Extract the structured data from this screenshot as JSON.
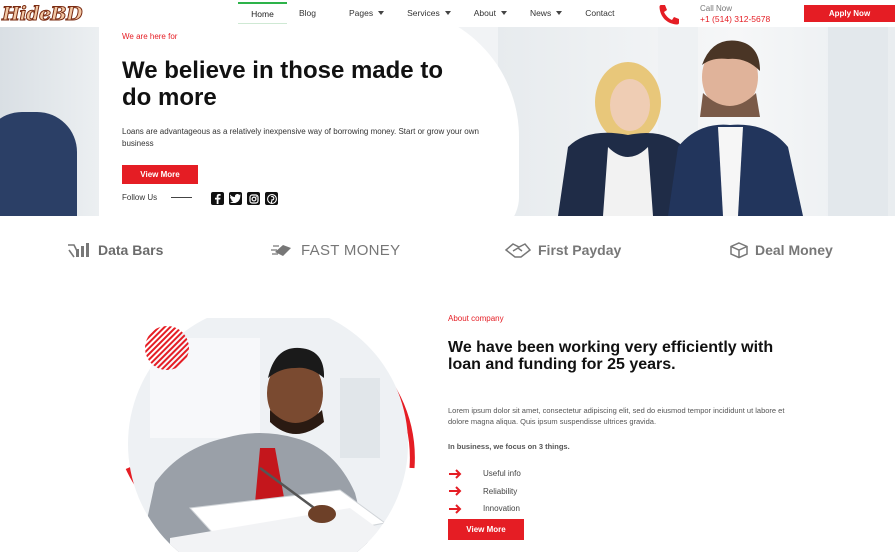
{
  "header": {
    "logo_text": "HideBD",
    "nav": [
      {
        "label": "Home",
        "has_dropdown": false,
        "active": true
      },
      {
        "label": "Blog",
        "has_dropdown": false,
        "active": false
      },
      {
        "label": "Pages",
        "has_dropdown": true,
        "active": false
      },
      {
        "label": "Services",
        "has_dropdown": true,
        "active": false
      },
      {
        "label": "About",
        "has_dropdown": true,
        "active": false
      },
      {
        "label": "News",
        "has_dropdown": true,
        "active": false
      },
      {
        "label": "Contact",
        "has_dropdown": false,
        "active": false
      }
    ],
    "call_label": "Call Now",
    "call_number": "+1 (514) 312-5678",
    "phone_icon": "phone-icon",
    "apply_label": "Apply Now"
  },
  "hero": {
    "kicker": "We are here for",
    "title": "We believe in those made to do more",
    "description": "Loans are advantageous as a relatively inexpensive way of borrowing money. Start or grow your own business",
    "button_label": "View More",
    "follow_label": "Follow Us",
    "socials": [
      "facebook-icon",
      "twitter-icon",
      "instagram-icon",
      "pinterest-icon"
    ]
  },
  "brands": [
    {
      "name": "Data Bars",
      "icon": "data-bars-icon"
    },
    {
      "name": "FAST MONEY",
      "icon": "fast-money-icon"
    },
    {
      "name": "First Payday",
      "icon": "handshake-icon"
    },
    {
      "name": "Deal Money",
      "icon": "box-icon"
    }
  ],
  "about": {
    "kicker": "About company",
    "title": "We have been working very efficiently with loan and funding for 25 years.",
    "description": "Lorem ipsum dolor sit amet, consectetur adipiscing elit, sed do eiusmod tempor incididunt ut labore et dolore magna aliqua. Quis ipsum suspendisse ultrices gravida.",
    "focus_label": "In business, we focus on 3 things.",
    "items": [
      "Useful info",
      "Reliability",
      "Innovation"
    ],
    "button_label": "View More"
  },
  "colors": {
    "accent": "#e51d24",
    "nav_active": "#2db34a",
    "brand_gray": "#777777"
  }
}
